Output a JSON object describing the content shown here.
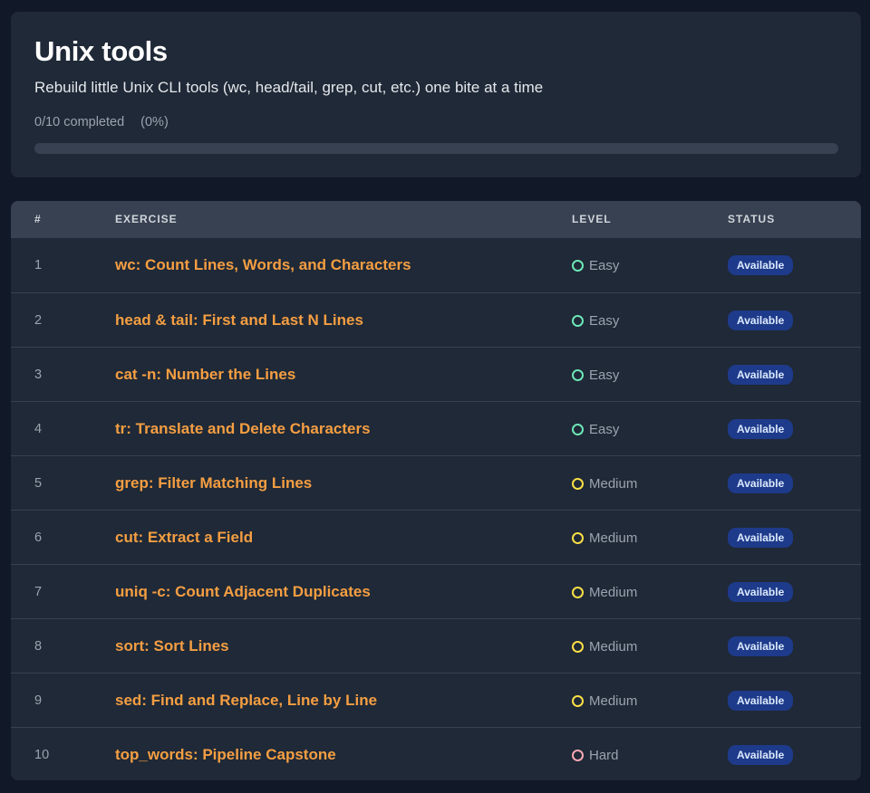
{
  "header": {
    "title": "Unix tools",
    "description": "Rebuild little Unix CLI tools (wc, head/tail, grep, cut, etc.) one bite at a time",
    "progress_label": "0/10 completed",
    "progress_pct_label": "(0%)",
    "progress_fraction": 0
  },
  "table": {
    "columns": {
      "num": "#",
      "exercise": "EXERCISE",
      "level": "LEVEL",
      "status": "STATUS"
    },
    "rows": [
      {
        "num": "1",
        "title": "wc: Count Lines, Words, and Characters",
        "level": "Easy",
        "status": "Available"
      },
      {
        "num": "2",
        "title": "head & tail: First and Last N Lines",
        "level": "Easy",
        "status": "Available"
      },
      {
        "num": "3",
        "title": "cat -n: Number the Lines",
        "level": "Easy",
        "status": "Available"
      },
      {
        "num": "4",
        "title": "tr: Translate and Delete Characters",
        "level": "Easy",
        "status": "Available"
      },
      {
        "num": "5",
        "title": "grep: Filter Matching Lines",
        "level": "Medium",
        "status": "Available"
      },
      {
        "num": "6",
        "title": "cut: Extract a Field",
        "level": "Medium",
        "status": "Available"
      },
      {
        "num": "7",
        "title": "uniq -c: Count Adjacent Duplicates",
        "level": "Medium",
        "status": "Available"
      },
      {
        "num": "8",
        "title": "sort: Sort Lines",
        "level": "Medium",
        "status": "Available"
      },
      {
        "num": "9",
        "title": "sed: Find and Replace, Line by Line",
        "level": "Medium",
        "status": "Available"
      },
      {
        "num": "10",
        "title": "top_words: Pipeline Capstone",
        "level": "Hard",
        "status": "Available"
      }
    ]
  },
  "level_colors": {
    "Easy": "#6ee7b7",
    "Medium": "#fde047",
    "Hard": "#f9a8b4"
  },
  "accent_color": "#f59e42"
}
